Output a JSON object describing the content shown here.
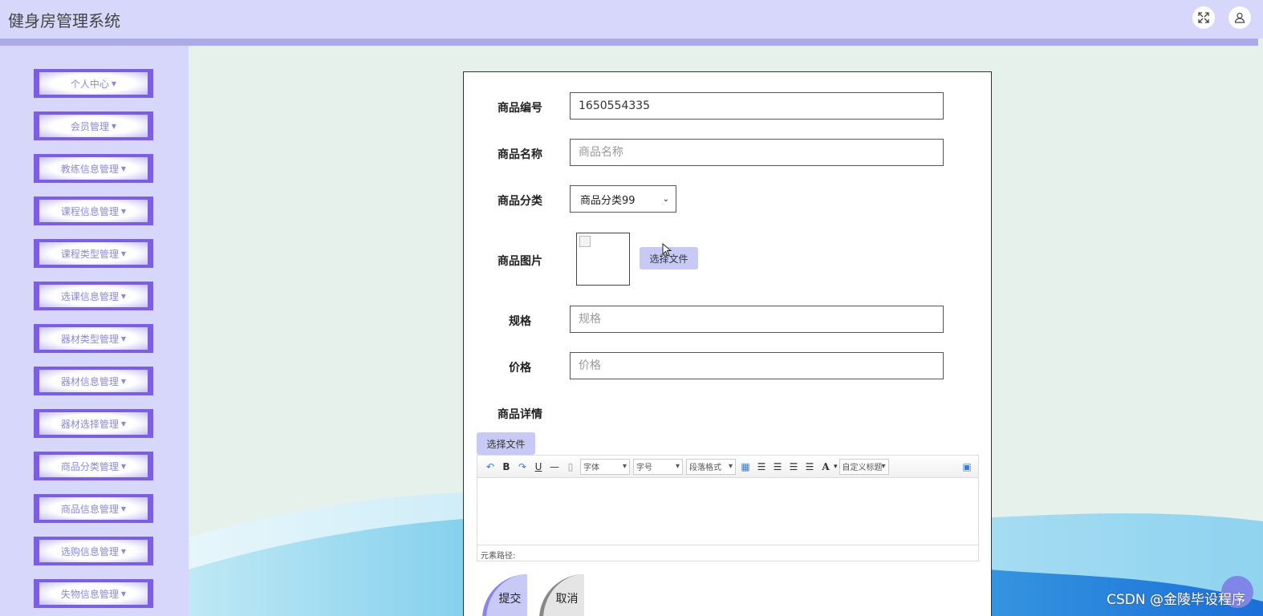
{
  "header": {
    "title": "健身房管理系统",
    "fullscreen_icon": "expand-icon",
    "user_icon": "user-icon"
  },
  "sidebar": {
    "items": [
      {
        "label": "个人中心"
      },
      {
        "label": "会员管理"
      },
      {
        "label": "教练信息管理"
      },
      {
        "label": "课程信息管理"
      },
      {
        "label": "课程类型管理"
      },
      {
        "label": "选课信息管理"
      },
      {
        "label": "器材类型管理"
      },
      {
        "label": "器材信息管理"
      },
      {
        "label": "器材选择管理"
      },
      {
        "label": "商品分类管理"
      },
      {
        "label": "商品信息管理"
      },
      {
        "label": "选购信息管理"
      },
      {
        "label": "失物信息管理"
      }
    ]
  },
  "form": {
    "code_label": "商品编号",
    "code_value": "1650554335",
    "name_label": "商品名称",
    "name_placeholder": "商品名称",
    "category_label": "商品分类",
    "category_value": "商品分类99",
    "image_label": "商品图片",
    "image_file_button": "选择文件",
    "spec_label": "规格",
    "spec_placeholder": "规格",
    "price_label": "价格",
    "price_placeholder": "价格",
    "detail_label": "商品详情",
    "detail_file_button": "选择文件",
    "submit_label": "提交",
    "cancel_label": "取消"
  },
  "editor": {
    "font_select": "字体",
    "size_select": "字号",
    "paragraph_select": "段落格式",
    "custom_title_select": "自定义标题",
    "status_path": "元素路径:"
  },
  "watermark": "CSDN @金陵毕设程序"
}
